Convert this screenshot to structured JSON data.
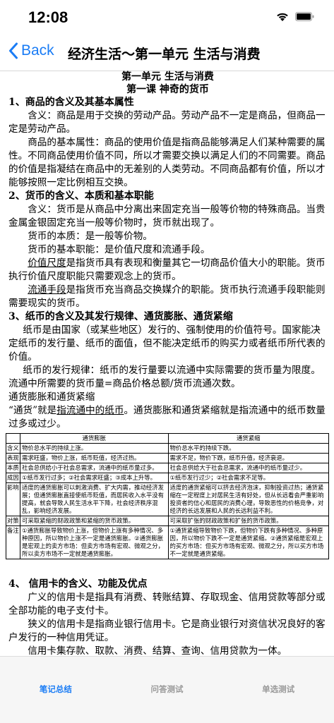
{
  "status": {
    "time": "12:08"
  },
  "nav": {
    "back_label": "Back",
    "title": "经济生活～第一单元 生活与消费"
  },
  "doc": {
    "title1": "第一单元 生活与消费",
    "title2": "第一课 神奇的货币",
    "s1": {
      "heading": "1、商品的含义及其基本属性",
      "p1": "含义：商品是用于交换的劳动产品。劳动产品不一定是商品，但商品一定是劳动产品。",
      "p2": "商品的基本属性：商品的使用价值是指商品能够满足人们某种需要的属性。不同商品使用价值不同，所以才需要交换以满足人们的不同需要。商品的价值是指凝结在商品中的无差别的人类劳动。不同商品都有价值，所以才能够按照一定比例相互交换。"
    },
    "s2": {
      "heading": "2、货币的含义、本质和基本职能",
      "p1": "含义：货币是从商品中分离出来固定充当一般等价物的特殊商品。当贵金属金银固定充当一般等价物时，货币就出现了。",
      "p2": "货币的本质：是一般等价物。",
      "p3": "货币的基本职能：是价值尺度和流通手段。",
      "p4_u": "价值尺度",
      "p4_rest": "是指货币具有表现和衡量其它一切商品价值大小的职能。货币执行价值尺度职能只需要观念上的货币。",
      "p5_u": "流通手段",
      "p5_rest": "是指货币充当商品交换媒介的职能。货币执行流通手段职能则需要现实的货币。"
    },
    "s3": {
      "heading": "3、纸币的含义及其发行规律、通货膨胀、通货紧缩",
      "p1": "纸币是由国家（或某些地区）发行的、强制使用的价值符号。国家能决定纸币的发行量、纸币的面值，但不能决定纸币的购买力或者纸币所代表的价值。",
      "p2": "纸币的发行规律：纸币的发行量要以流通中实际需要的货币量为限度。流通中所需要的货币量=商品价格总额/货币流通次数。",
      "p3": "通货膨胀和通货紧缩",
      "p4_a": "“通货”就是",
      "p4_u": "指流通中的纸币",
      "p4_b": "。通货膨胀和通货紧缩就是指流通中的纸币数量过多或过少。"
    },
    "table": {
      "head_a": "通货膨胀",
      "head_b": "通货紧缩",
      "rows": [
        {
          "label": "含义",
          "a": "物价总水平的持续上涨。",
          "b": "物价总水平的持续下跌。"
        },
        {
          "label": "表现",
          "a": "需求旺盛，物价上涨，纸币贬值，经济过热。",
          "b": "需求不足，物价下跌，纸币升值，经济衰退。"
        },
        {
          "label": "本质",
          "a": "社会总供给小于社会总需求，流通中的纸币量过多。",
          "b": "社会总供给大于社会总需求，流通中的纸币量过少。"
        },
        {
          "label": "成因",
          "a": "①纸币发行过多；②社会需求旺盛；③成本上升等。",
          "b": "①纸币发行过少；②社会需求不足等。"
        },
        {
          "label": "影响",
          "a": "适度的通货膨胀可以刺激消费、扩大内需，推动经济发展；但通货膨胀直接使纸币贬值，而居民收入水平没有提高，就会导致人民生活水平下降，社会经济秩序混乱，影响经济发展。",
          "b": "适度的通货紧缩可以挤去经济泡沫，抑制投资过热；通货紧缩在一定程度上对居民生活有好处，但从长远看会严重影响投资者的信心和居民的消费心理，导致恶性的价格竞争，对经济的长远发展和人民的长远利益不利。"
        },
        {
          "label": "对策",
          "a": "可采取紧缩的财政政策和紧缩的货币政策。",
          "b": "可采取扩张的财政政策和扩张的货币政策。"
        },
        {
          "label": "备注",
          "a": "①通货膨胀导致物价上涨，但物价上涨有多种情况、多种原因，所以物价上涨不一定是通货膨胀。②通货膨胀是宏观上的卖方市场：但卖方市场有宏观、微观之分，所以卖方市场不一定就是通货膨胀。",
          "b": "①通货紧缩导致物价下跌，但物价下跌有多种情况、多种原因，所以物价下跌不一定是通货紧缩。②通货紧缩是宏观上的买方市场：但买方市场有宏观、微观之分，所以买方市场不一定就是通货紧缩。"
        }
      ]
    },
    "s4": {
      "heading": "4、 信用卡的含义、功能及优点",
      "p1": "广义的信用卡是指具有消费、转账结算、存取现金、信用贷款等部分或全部功能的电子支付卡。",
      "p2": "狭义的信用卡是指商业银行信用卡。它是商业银行对资信状况良好的客户发行的一种信用凭证。",
      "p3": "信用卡集存款、取款、消费、结算、查询、信用贷款为一体。"
    }
  },
  "tabs": [
    {
      "label": "笔记总结",
      "active": true
    },
    {
      "label": "问答测试",
      "active": false
    },
    {
      "label": "单选测试",
      "active": false
    }
  ],
  "colors": {
    "accent": "#1a7cf5",
    "tab_inactive": "#999999"
  }
}
